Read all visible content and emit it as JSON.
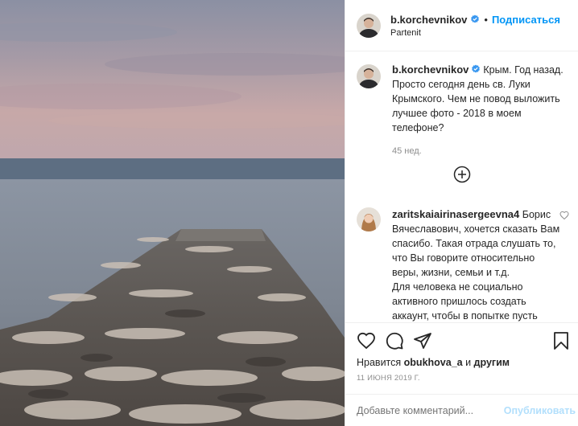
{
  "header": {
    "username": "b.korchevnikov",
    "separator": "•",
    "follow_label": "Подписаться",
    "location": "Partenit"
  },
  "caption": {
    "username": "b.korchevnikov",
    "text": "Крым. Год назад. Просто сегодня день св. Луки Крымского. Чем не повод выложить лучшее фото - 2018 в моем телефоне?",
    "time": "45 нед."
  },
  "comment": {
    "username": "zaritskaiairinasergeevna4",
    "text_1": "Борис Вячеславович, хочется сказать Вам спасибо. Такая отрада слушать то, что Вы говорите относительно веры, жизни, семьи и т.д.",
    "text_2": "Для человека не социально активного пришлось создать аккаунт, чтобы в попытке пусть"
  },
  "likes": {
    "prefix": "Нравится",
    "user": "obukhova_a",
    "middle": "и",
    "others": "другим"
  },
  "date": "11 ИЮНЯ 2019 Г.",
  "add_comment": {
    "placeholder": "Добавьте комментарий...",
    "publish_label": "Опубликовать"
  },
  "icons": {
    "verified": "verified-badge-icon",
    "load_more": "plus-circle-icon",
    "like": "heart-icon",
    "comment": "comment-bubble-icon",
    "share": "paper-plane-icon",
    "save": "bookmark-icon"
  },
  "colors": {
    "accent": "#0095f6",
    "publish_disabled": "#b2dffc",
    "muted": "#8e8e8e"
  }
}
